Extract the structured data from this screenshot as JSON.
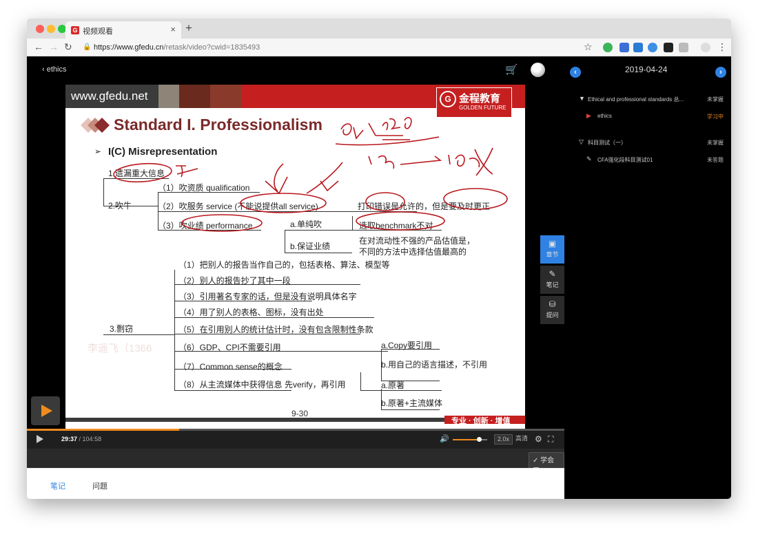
{
  "browser": {
    "tab_title": "视频观看",
    "tab_favicon": "G",
    "new_tab": "+",
    "close_tab": "×",
    "url_host": "https://www.gfedu.cn",
    "url_path": "/retask/video?cwid=1835493"
  },
  "player": {
    "back_label": "ethics",
    "current_time": "29:37",
    "duration": "/ 104:58",
    "progress_fraction": 0.283,
    "volume_fraction": 0.76,
    "speed": "2.0x",
    "quality": "高清",
    "learned_label": "学会了"
  },
  "slide": {
    "site": "www.gfedu.net",
    "logo_cn": "金程教育",
    "logo_en": "GOLDEN FUTURE",
    "title": "Standard I. Professionalism",
    "subtitle": "I(C) Misrepresentation",
    "items": {
      "omission": "1.遗漏重大信息",
      "brag": "2.吹牛",
      "brag_1": "（1）吹资质 qualification",
      "brag_2": "（2）吹服务 service (不能说提供all service)",
      "brag_3": "（3）吹业绩 performance",
      "brag_note": "打印错误是允许的，但是要及时更正",
      "perf_a": "a.单纯吹",
      "perf_a_note": "选取benchmark不对",
      "perf_b": "b.保证业绩",
      "perf_b_note1": "在对流动性不强的产品估值是，",
      "perf_b_note2": "不同的方法中选择估值最高的",
      "plagiarism": "3.剽窃",
      "p1": "（1）把别人的报告当作自己的，包括表格、算法、模型等",
      "p2": "（2）别人的报告抄了其中一段",
      "p3": "（3）引用著名专家的话，但是没有说明具体名字",
      "p4": "（4）用了别人的表格、图标，没有出处",
      "p5": "（5）在引用别人的统计估计时，没有包含限制性条款",
      "p6": "（6）GDP、CPI不需要引用",
      "p7": "（7）Common sense的概念",
      "p8": "（8）从主流媒体中获得信息 先verify，再引用",
      "p6_a": "a.Copy要引用",
      "p7_b": "b.用自己的语言描述，不引用",
      "p8_a": "a.原著",
      "p8_b": "b.原著+主流媒体"
    },
    "watermark": "李遥飞（1366",
    "page": "9-30",
    "footer": "专业 · 创新 · 增值"
  },
  "side_tools": [
    {
      "label": "章节",
      "icon": "chapter-icon"
    },
    {
      "label": "笔记",
      "icon": "pencil-icon"
    },
    {
      "label": "提问",
      "icon": "database-icon"
    }
  ],
  "below_tabs": [
    "笔记",
    "问题"
  ],
  "panel": {
    "date": "2019-04-24",
    "rows": [
      {
        "label": "Ethical and professional standards 总...",
        "status": "未掌握",
        "type": "chapter"
      },
      {
        "label": "ethics",
        "status": "学习中",
        "type": "video"
      },
      {
        "label": "科目测试（一）",
        "status": "未掌握",
        "type": "chapter"
      },
      {
        "label": "CFA强化段科目测试01",
        "status": "未答题",
        "type": "test"
      }
    ]
  },
  "colors": {
    "accent_blue": "#2f82e3",
    "accent_orange": "#f08c1e",
    "slide_red": "#c51f1f"
  }
}
